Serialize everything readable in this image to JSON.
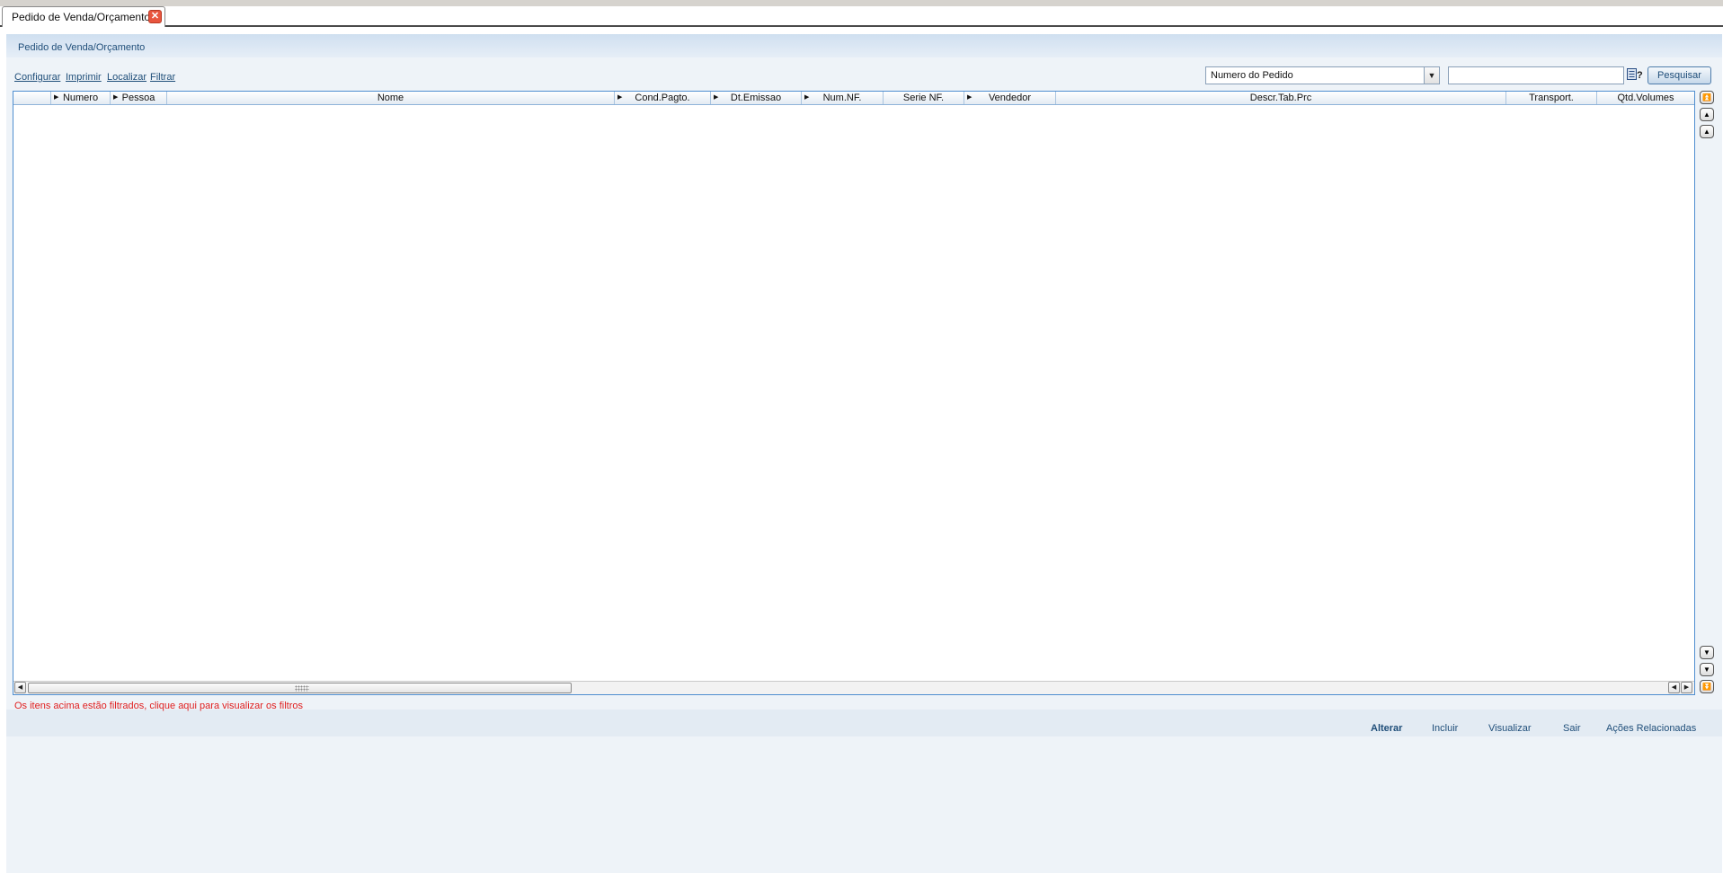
{
  "tab": {
    "title": "Pedido de Venda/Orçamento",
    "close_glyph": "✕"
  },
  "header": {
    "title": "Pedido de Venda/Orçamento"
  },
  "toolbar": {
    "links": [
      "Configurar",
      "Imprimir",
      "Localizar",
      "Filtrar"
    ],
    "search_field": {
      "selected": "Numero do Pedido",
      "options": [
        "Numero do Pedido"
      ]
    },
    "search_value": "",
    "search_button": "Pesquisar"
  },
  "grid": {
    "columns": [
      {
        "label": "",
        "sort": false
      },
      {
        "label": "Numero",
        "sort": true
      },
      {
        "label": "Pessoa",
        "sort": true
      },
      {
        "label": "Nome",
        "sort": false
      },
      {
        "label": "Cond.Pagto.",
        "sort": true
      },
      {
        "label": "Dt.Emissao",
        "sort": true
      },
      {
        "label": "Num.NF.",
        "sort": true
      },
      {
        "label": "Serie NF.",
        "sort": false
      },
      {
        "label": "Vendedor",
        "sort": true
      },
      {
        "label": "Descr.Tab.Prc",
        "sort": false
      },
      {
        "label": "Transport.",
        "sort": false
      },
      {
        "label": "Qtd.Volumes",
        "sort": false
      }
    ],
    "rows": []
  },
  "filter_message": "Os itens acima estão filtrados, clique aqui para visualizar os filtros",
  "footer": {
    "buttons": [
      "Alterar",
      "Incluir",
      "Visualizar",
      "Sair",
      "Ações Relacionadas"
    ]
  },
  "icons": {
    "close": "close-icon",
    "dropdown": "chevron-down-icon",
    "helper": "field-helper-icon",
    "scroll_first": "scroll-first-icon",
    "scroll_page_up": "scroll-page-up-icon",
    "scroll_up": "scroll-up-icon",
    "scroll_down": "scroll-down-icon",
    "scroll_page_down": "scroll-page-down-icon",
    "scroll_last": "scroll-last-icon"
  },
  "colors": {
    "accent": "#1f4e79",
    "grid_border": "#4f8ed0",
    "warning_text": "#e02020",
    "close_button": "#e8553e"
  }
}
